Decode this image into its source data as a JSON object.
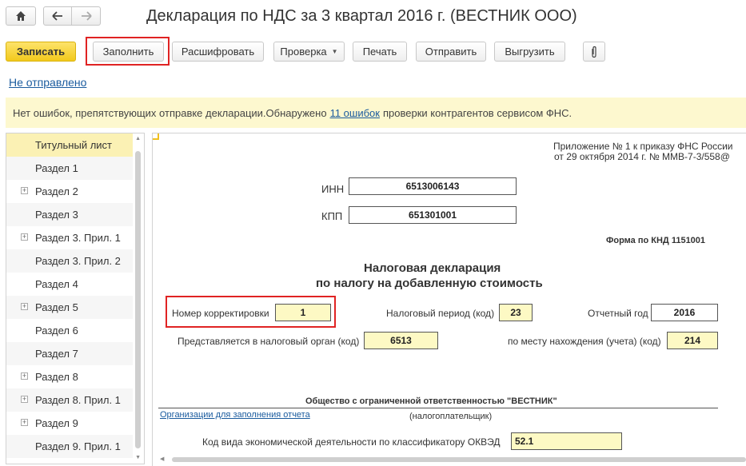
{
  "window": {
    "title": "Декларация по НДС за 3 квартал 2016 г. (ВЕСТНИК ООО)",
    "icons": {
      "home": "home-icon",
      "back": "arrow-left-icon",
      "forward": "arrow-right-icon",
      "clip": "paperclip-icon"
    }
  },
  "toolbar": {
    "save_label": "Записать",
    "fill_label": "Заполнить",
    "decode_label": "Расшифровать",
    "check_label": "Проверка",
    "print_label": "Печать",
    "send_label": "Отправить",
    "export_label": "Выгрузить"
  },
  "status": {
    "link_text": "Не отправлено"
  },
  "info": {
    "text_before": "Нет ошибок, препятствующих отправке декларации.Обнаружено",
    "link_text": "11 ошибок",
    "text_after": "проверки контрагентов сервисом ФНС."
  },
  "sidebar": {
    "items": [
      {
        "label": "Титульный лист",
        "expandable": false,
        "selected": true
      },
      {
        "label": "Раздел 1",
        "expandable": false
      },
      {
        "label": "Раздел 2",
        "expandable": true
      },
      {
        "label": "Раздел 3",
        "expandable": false
      },
      {
        "label": "Раздел 3. Прил. 1",
        "expandable": true
      },
      {
        "label": "Раздел 3. Прил. 2",
        "expandable": false
      },
      {
        "label": "Раздел 4",
        "expandable": false
      },
      {
        "label": "Раздел 5",
        "expandable": true
      },
      {
        "label": "Раздел 6",
        "expandable": false
      },
      {
        "label": "Раздел 7",
        "expandable": false
      },
      {
        "label": "Раздел 8",
        "expandable": true
      },
      {
        "label": "Раздел 8. Прил. 1",
        "expandable": true
      },
      {
        "label": "Раздел 9",
        "expandable": true
      },
      {
        "label": "Раздел 9. Прил. 1",
        "expandable": false
      }
    ]
  },
  "form": {
    "appendix_line1": "Приложение № 1 к приказу ФНС России",
    "appendix_line2": "от 29 октября 2014 г. № ММВ-7-3/558@",
    "inn_label": "ИНН",
    "inn_value": "6513006143",
    "kpp_label": "КПП",
    "kpp_value": "651301001",
    "knd": "Форма по КНД 1151001",
    "heading1": "Налоговая декларация",
    "heading2": "по налогу на добавленную стоимость",
    "correction_label": "Номер корректировки",
    "correction_value": "1",
    "period_label": "Налоговый период (код)",
    "period_value": "23",
    "year_label": "Отчетный год",
    "year_value": "2016",
    "authority_label": "Представляется в налоговый орган (код)",
    "authority_value": "6513",
    "place_label": "по месту нахождения (учета) (код)",
    "place_value": "214",
    "org_name": "Общество с ограниченной ответственностью \"ВЕСТНИК\"",
    "org_link": "Организации для заполнения отчета",
    "taxpayer_caption": "(налогоплательщик)",
    "okved_label": "Код вида экономической деятельности по классификатору ОКВЭД",
    "okved_value": "52.1"
  }
}
